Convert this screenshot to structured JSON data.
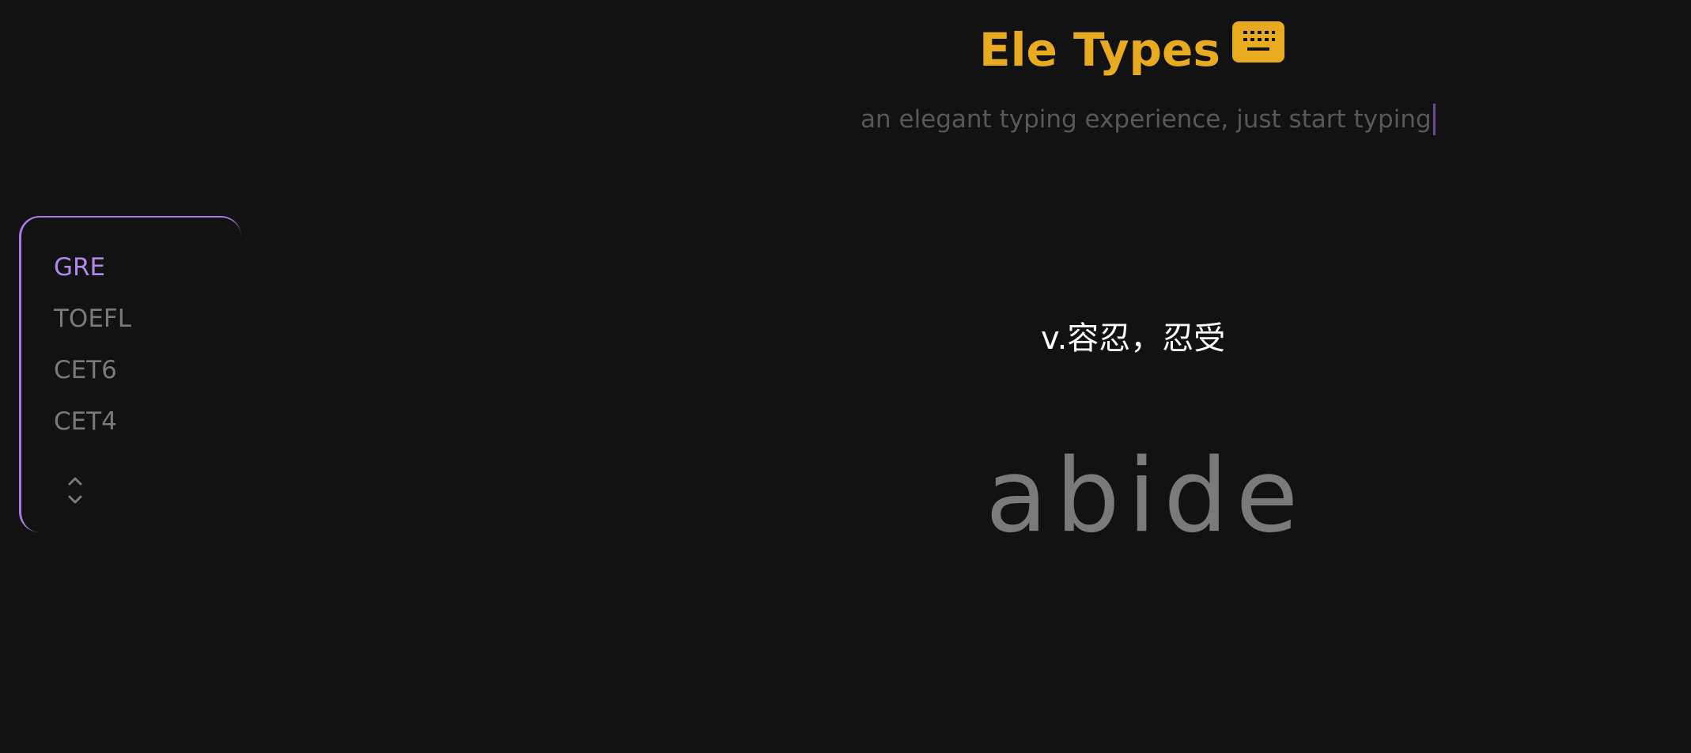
{
  "header": {
    "title": "Ele Types",
    "title_icon": "keyboard-icon",
    "tagline": "an elegant typing experience, just start typing"
  },
  "dictionary_menu": {
    "items": [
      {
        "label": "GRE",
        "active": true
      },
      {
        "label": "TOEFL",
        "active": false
      },
      {
        "label": "CET6",
        "active": false
      },
      {
        "label": "CET4",
        "active": false
      }
    ],
    "expand_icon": "chevron-up-down-icon"
  },
  "word_card": {
    "definition": "v.容忍，忍受",
    "word": "abide"
  },
  "colors": {
    "background": "#121212",
    "brand": "#e8ab1f",
    "accent": "#a77be6",
    "muted_text": "#7a7a7a"
  }
}
